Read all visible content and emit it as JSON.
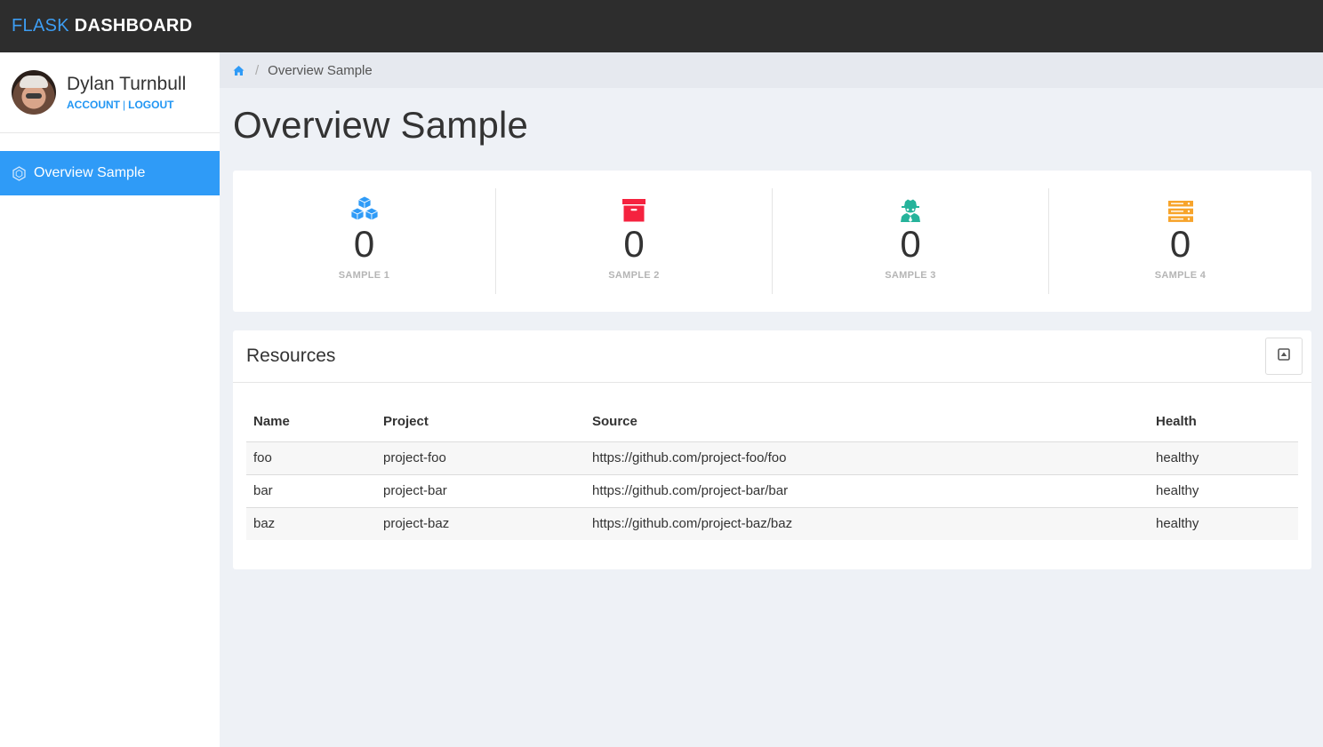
{
  "brand": {
    "part1": "FLASK",
    "part2": "DASHBOARD"
  },
  "user": {
    "name": "Dylan Turnbull",
    "account_label": "ACCOUNT",
    "separator": "|",
    "logout_label": "LOGOUT"
  },
  "sidebar": {
    "items": [
      {
        "label": "Overview Sample",
        "icon": "hexagon-icon",
        "active": true
      }
    ]
  },
  "breadcrumb": {
    "home_icon": "home-icon",
    "separator": "/",
    "current": "Overview Sample"
  },
  "page": {
    "title": "Overview Sample"
  },
  "stats": [
    {
      "value": "0",
      "label": "SAMPLE 1",
      "icon": "cubes-icon",
      "color": "#2f9bf7"
    },
    {
      "value": "0",
      "label": "SAMPLE 2",
      "icon": "archive-icon",
      "color": "#f5223f"
    },
    {
      "value": "0",
      "label": "SAMPLE 3",
      "icon": "user-secret-icon",
      "color": "#26b39b"
    },
    {
      "value": "0",
      "label": "SAMPLE 4",
      "icon": "server-icon",
      "color": "#f7a42b"
    }
  ],
  "resources": {
    "title": "Resources",
    "collapse_icon": "caret-square-up-icon",
    "columns": [
      "Name",
      "Project",
      "Source",
      "Health"
    ],
    "rows": [
      [
        "foo",
        "project-foo",
        "https://github.com/project-foo/foo",
        "healthy"
      ],
      [
        "bar",
        "project-bar",
        "https://github.com/project-bar/bar",
        "healthy"
      ],
      [
        "baz",
        "project-baz",
        "https://github.com/project-baz/baz",
        "healthy"
      ]
    ]
  }
}
